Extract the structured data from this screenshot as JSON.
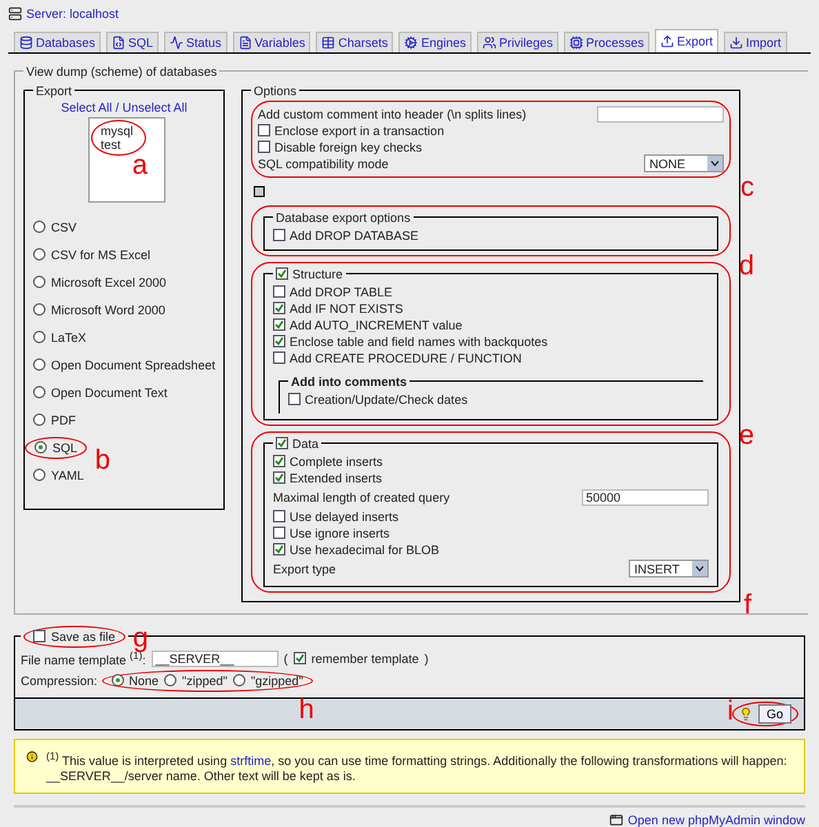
{
  "server": {
    "title": "Server: localhost"
  },
  "tabs": [
    {
      "label": "Databases",
      "selected": false
    },
    {
      "label": "SQL",
      "selected": false
    },
    {
      "label": "Status",
      "selected": false
    },
    {
      "label": "Variables",
      "selected": false
    },
    {
      "label": "Charsets",
      "selected": false
    },
    {
      "label": "Engines",
      "selected": false
    },
    {
      "label": "Privileges",
      "selected": false
    },
    {
      "label": "Processes",
      "selected": false
    },
    {
      "label": "Export",
      "selected": true
    },
    {
      "label": "Import",
      "selected": false
    }
  ],
  "dump": {
    "title": "View dump (scheme) of databases",
    "export": {
      "title": "Export",
      "select_all": "Select All / Unselect All",
      "databases": [
        "mysql",
        "test"
      ],
      "databases_callout": "a",
      "formats": [
        {
          "label": "CSV",
          "selected": false
        },
        {
          "label": "CSV for MS Excel",
          "selected": false
        },
        {
          "label": "Microsoft Excel 2000",
          "selected": false
        },
        {
          "label": "Microsoft Word 2000",
          "selected": false
        },
        {
          "label": "LaTeX",
          "selected": false
        },
        {
          "label": "Open Document Spreadsheet",
          "selected": false
        },
        {
          "label": "Open Document Text",
          "selected": false
        },
        {
          "label": "PDF",
          "selected": false
        },
        {
          "label": "SQL",
          "selected": true,
          "callout": "b"
        },
        {
          "label": "YAML",
          "selected": false
        }
      ]
    },
    "options": {
      "title": "Options",
      "callout": "c",
      "comment": {
        "label": "Add custom comment into header (\\n splits lines)"
      },
      "checks": [
        {
          "label": "Enclose export in a transaction",
          "checked": false
        },
        {
          "label": "Disable foreign key checks",
          "checked": false
        }
      ],
      "compat": {
        "label": "SQL compatibility mode",
        "value": "NONE"
      },
      "database": {
        "title": "Database export options",
        "callout": "d",
        "checks": [
          {
            "label": "Add DROP DATABASE",
            "checked": false
          }
        ]
      },
      "structure": {
        "title": "Structure",
        "checked": true,
        "callout": "e",
        "checks": [
          {
            "label": "Add DROP TABLE",
            "checked": false
          },
          {
            "label": "Add IF NOT EXISTS",
            "checked": true
          },
          {
            "label": "Add AUTO_INCREMENT value",
            "checked": true
          },
          {
            "label": "Enclose table and field names with backquotes",
            "checked": true
          },
          {
            "label": "Add CREATE PROCEDURE / FUNCTION",
            "checked": false
          }
        ],
        "comments": {
          "title": "Add into comments",
          "checks": [
            {
              "label": "Creation/Update/Check dates",
              "checked": false
            }
          ]
        }
      },
      "data": {
        "title": "Data",
        "checked": true,
        "callout": "f",
        "items": [
          {
            "kind": "check",
            "label": "Complete inserts",
            "checked": true
          },
          {
            "kind": "check",
            "label": "Extended inserts",
            "checked": true
          },
          {
            "kind": "input",
            "label": "Maximal length of created query",
            "value": "50000"
          },
          {
            "kind": "check",
            "label": "Use delayed inserts",
            "checked": false
          },
          {
            "kind": "check",
            "label": "Use ignore inserts",
            "checked": false
          },
          {
            "kind": "check",
            "label": "Use hexadecimal for BLOB",
            "checked": true
          },
          {
            "kind": "select",
            "label": "Export type",
            "value": "INSERT"
          }
        ]
      }
    }
  },
  "save": {
    "title": "Save as file",
    "checked": false,
    "callout": "g",
    "template_label": "File name template $^{(1)}$:",
    "template_value": "__SERVER__",
    "open": "(",
    "remember": {
      "label": "remember template",
      "checked": true
    },
    "close": ")",
    "compression": {
      "label": "Compression:",
      "callout": "h",
      "options": [
        {
          "label": "None",
          "selected": true
        },
        {
          "label": "\"zipped\"",
          "selected": false
        },
        {
          "label": "\"gzipped\"",
          "selected": false
        }
      ]
    }
  },
  "go": {
    "label": "Go",
    "callout": "i"
  },
  "notice": {
    "before": "$^{(1)}$ This value is interpreted using ",
    "link": "strftime",
    "after": ", so you can use time formatting strings. Additionally the following transformations will happen: __SERVER__/server name. Other text will be kept as is."
  },
  "footer": {
    "link": "Open new phpMyAdmin window"
  }
}
